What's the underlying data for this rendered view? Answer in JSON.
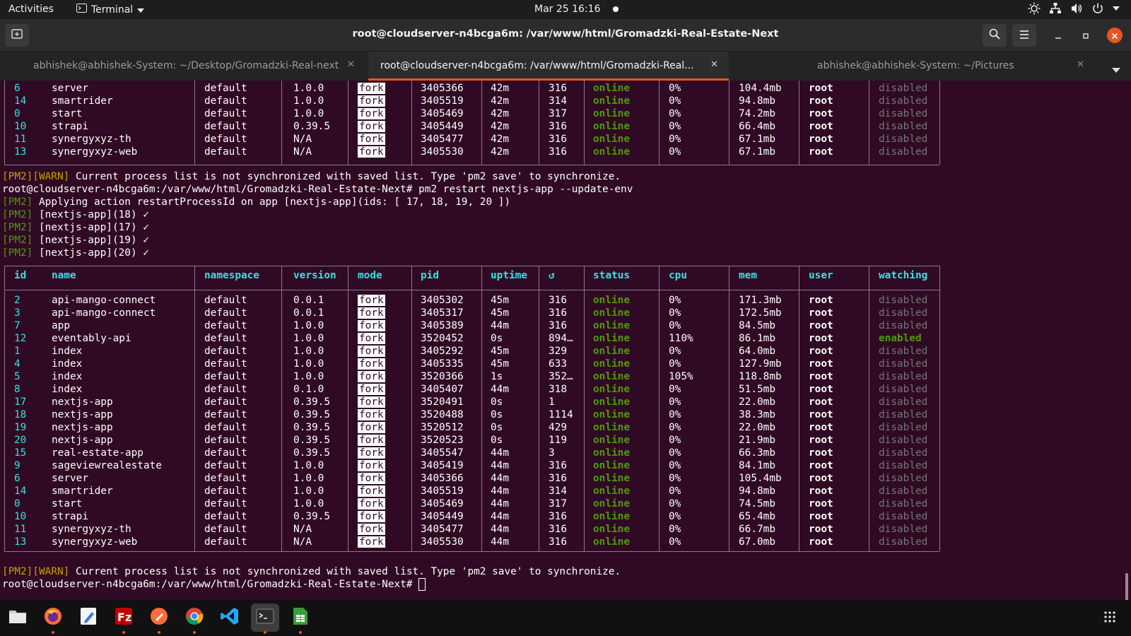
{
  "topbar": {
    "activities": "Activities",
    "app_name": "Terminal",
    "clock": "Mar 25  16:16"
  },
  "window": {
    "title": "root@cloudserver-n4bcga6m: /var/www/html/Gromadzki-Real-Estate-Next"
  },
  "tabs": [
    {
      "label": "abhishek@abhishek-System: ~/Desktop/Gromadzki-Real-next",
      "active": false
    },
    {
      "label": "root@cloudserver-n4bcga6m: /var/www/html/Gromadzki-Real...",
      "active": true
    },
    {
      "label": "abhishek@abhishek-System: ~/Pictures",
      "active": false
    }
  ],
  "close_glyph": "✕",
  "prev_table_rows": [
    {
      "id": "6",
      "name": "server",
      "namespace": "default",
      "version": "1.0.0",
      "mode": "fork",
      "pid": "3405366",
      "uptime": "42m",
      "restarts": "316",
      "status": "online",
      "cpu": "0%",
      "mem": "104.4mb",
      "user": "root",
      "watching": "disabled"
    },
    {
      "id": "14",
      "name": "smartrider",
      "namespace": "default",
      "version": "1.0.0",
      "mode": "fork",
      "pid": "3405519",
      "uptime": "42m",
      "restarts": "314",
      "status": "online",
      "cpu": "0%",
      "mem": "94.8mb",
      "user": "root",
      "watching": "disabled"
    },
    {
      "id": "0",
      "name": "start",
      "namespace": "default",
      "version": "1.0.0",
      "mode": "fork",
      "pid": "3405469",
      "uptime": "42m",
      "restarts": "317",
      "status": "online",
      "cpu": "0%",
      "mem": "74.2mb",
      "user": "root",
      "watching": "disabled"
    },
    {
      "id": "10",
      "name": "strapi",
      "namespace": "default",
      "version": "0.39.5",
      "mode": "fork",
      "pid": "3405449",
      "uptime": "42m",
      "restarts": "316",
      "status": "online",
      "cpu": "0%",
      "mem": "66.4mb",
      "user": "root",
      "watching": "disabled"
    },
    {
      "id": "11",
      "name": "synergyxyz-th",
      "namespace": "default",
      "version": "N/A",
      "mode": "fork",
      "pid": "3405477",
      "uptime": "42m",
      "restarts": "316",
      "status": "online",
      "cpu": "0%",
      "mem": "67.1mb",
      "user": "root",
      "watching": "disabled"
    },
    {
      "id": "13",
      "name": "synergyxyz-web",
      "namespace": "default",
      "version": "N/A",
      "mode": "fork",
      "pid": "3405530",
      "uptime": "42m",
      "restarts": "316",
      "status": "online",
      "cpu": "0%",
      "mem": "67.1mb",
      "user": "root",
      "watching": "disabled"
    }
  ],
  "log_lines": {
    "warn1_tag": "[PM2][WARN]",
    "warn1_text": " Current process list is not synchronized with saved list. Type 'pm2 save' to synchronize.",
    "command": "root@cloudserver-n4bcga6m:/var/www/html/Gromadzki-Real-Estate-Next# pm2 restart nextjs-app --update-env",
    "pm2_tag": "[PM2]",
    "apply": " Applying action restartProcessId on app [nextjs-app](ids: [ 17, 18, 19, 20 ])",
    "ok1": " [nextjs-app](18) ✓",
    "ok2": " [nextjs-app](17) ✓",
    "ok3": " [nextjs-app](19) ✓",
    "ok4": " [nextjs-app](20) ✓",
    "warn2_tag": "[PM2][WARN]",
    "warn2_text": " Current process list is not synchronized with saved list. Type 'pm2 save' to synchronize.",
    "prompt": "root@cloudserver-n4bcga6m:/var/www/html/Gromadzki-Real-Estate-Next# "
  },
  "table_headers": [
    "id",
    "name",
    "namespace",
    "version",
    "mode",
    "pid",
    "uptime",
    "↺",
    "status",
    "cpu",
    "mem",
    "user",
    "watching"
  ],
  "table_rows": [
    {
      "id": "2",
      "name": "api-mango-connect",
      "namespace": "default",
      "version": "0.0.1",
      "mode": "fork",
      "pid": "3405302",
      "uptime": "45m",
      "restarts": "316",
      "status": "online",
      "cpu": "0%",
      "mem": "171.3mb",
      "user": "root",
      "watching": "disabled"
    },
    {
      "id": "3",
      "name": "api-mango-connect",
      "namespace": "default",
      "version": "0.0.1",
      "mode": "fork",
      "pid": "3405317",
      "uptime": "45m",
      "restarts": "316",
      "status": "online",
      "cpu": "0%",
      "mem": "172.5mb",
      "user": "root",
      "watching": "disabled"
    },
    {
      "id": "7",
      "name": "app",
      "namespace": "default",
      "version": "1.0.0",
      "mode": "fork",
      "pid": "3405389",
      "uptime": "44m",
      "restarts": "316",
      "status": "online",
      "cpu": "0%",
      "mem": "84.5mb",
      "user": "root",
      "watching": "disabled"
    },
    {
      "id": "12",
      "name": "eventably-api",
      "namespace": "default",
      "version": "1.0.0",
      "mode": "fork",
      "pid": "3520452",
      "uptime": "0s",
      "restarts": "894…",
      "status": "online",
      "cpu": "110%",
      "mem": "86.1mb",
      "user": "root",
      "watching": "enabled"
    },
    {
      "id": "1",
      "name": "index",
      "namespace": "default",
      "version": "1.0.0",
      "mode": "fork",
      "pid": "3405292",
      "uptime": "45m",
      "restarts": "329",
      "status": "online",
      "cpu": "0%",
      "mem": "64.0mb",
      "user": "root",
      "watching": "disabled"
    },
    {
      "id": "4",
      "name": "index",
      "namespace": "default",
      "version": "1.0.0",
      "mode": "fork",
      "pid": "3405335",
      "uptime": "45m",
      "restarts": "633",
      "status": "online",
      "cpu": "0%",
      "mem": "127.9mb",
      "user": "root",
      "watching": "disabled"
    },
    {
      "id": "5",
      "name": "index",
      "namespace": "default",
      "version": "1.0.0",
      "mode": "fork",
      "pid": "3520366",
      "uptime": "1s",
      "restarts": "352…",
      "status": "online",
      "cpu": "105%",
      "mem": "118.8mb",
      "user": "root",
      "watching": "disabled"
    },
    {
      "id": "8",
      "name": "index",
      "namespace": "default",
      "version": "0.1.0",
      "mode": "fork",
      "pid": "3405407",
      "uptime": "44m",
      "restarts": "318",
      "status": "online",
      "cpu": "0%",
      "mem": "51.5mb",
      "user": "root",
      "watching": "disabled"
    },
    {
      "id": "17",
      "name": "nextjs-app",
      "namespace": "default",
      "version": "0.39.5",
      "mode": "fork",
      "pid": "3520491",
      "uptime": "0s",
      "restarts": "1",
      "status": "online",
      "cpu": "0%",
      "mem": "22.0mb",
      "user": "root",
      "watching": "disabled"
    },
    {
      "id": "18",
      "name": "nextjs-app",
      "namespace": "default",
      "version": "0.39.5",
      "mode": "fork",
      "pid": "3520488",
      "uptime": "0s",
      "restarts": "1114",
      "status": "online",
      "cpu": "0%",
      "mem": "38.3mb",
      "user": "root",
      "watching": "disabled"
    },
    {
      "id": "19",
      "name": "nextjs-app",
      "namespace": "default",
      "version": "0.39.5",
      "mode": "fork",
      "pid": "3520512",
      "uptime": "0s",
      "restarts": "429",
      "status": "online",
      "cpu": "0%",
      "mem": "22.0mb",
      "user": "root",
      "watching": "disabled"
    },
    {
      "id": "20",
      "name": "nextjs-app",
      "namespace": "default",
      "version": "0.39.5",
      "mode": "fork",
      "pid": "3520523",
      "uptime": "0s",
      "restarts": "119",
      "status": "online",
      "cpu": "0%",
      "mem": "21.9mb",
      "user": "root",
      "watching": "disabled"
    },
    {
      "id": "15",
      "name": "real-estate-app",
      "namespace": "default",
      "version": "0.39.5",
      "mode": "fork",
      "pid": "3405547",
      "uptime": "44m",
      "restarts": "3",
      "status": "online",
      "cpu": "0%",
      "mem": "66.3mb",
      "user": "root",
      "watching": "disabled"
    },
    {
      "id": "9",
      "name": "sageviewrealestate",
      "namespace": "default",
      "version": "1.0.0",
      "mode": "fork",
      "pid": "3405419",
      "uptime": "44m",
      "restarts": "316",
      "status": "online",
      "cpu": "0%",
      "mem": "84.1mb",
      "user": "root",
      "watching": "disabled"
    },
    {
      "id": "6",
      "name": "server",
      "namespace": "default",
      "version": "1.0.0",
      "mode": "fork",
      "pid": "3405366",
      "uptime": "44m",
      "restarts": "316",
      "status": "online",
      "cpu": "0%",
      "mem": "105.4mb",
      "user": "root",
      "watching": "disabled"
    },
    {
      "id": "14",
      "name": "smartrider",
      "namespace": "default",
      "version": "1.0.0",
      "mode": "fork",
      "pid": "3405519",
      "uptime": "44m",
      "restarts": "314",
      "status": "online",
      "cpu": "0%",
      "mem": "94.8mb",
      "user": "root",
      "watching": "disabled"
    },
    {
      "id": "0",
      "name": "start",
      "namespace": "default",
      "version": "1.0.0",
      "mode": "fork",
      "pid": "3405469",
      "uptime": "44m",
      "restarts": "317",
      "status": "online",
      "cpu": "0%",
      "mem": "74.5mb",
      "user": "root",
      "watching": "disabled"
    },
    {
      "id": "10",
      "name": "strapi",
      "namespace": "default",
      "version": "0.39.5",
      "mode": "fork",
      "pid": "3405449",
      "uptime": "44m",
      "restarts": "316",
      "status": "online",
      "cpu": "0%",
      "mem": "65.4mb",
      "user": "root",
      "watching": "disabled"
    },
    {
      "id": "11",
      "name": "synergyxyz-th",
      "namespace": "default",
      "version": "N/A",
      "mode": "fork",
      "pid": "3405477",
      "uptime": "44m",
      "restarts": "316",
      "status": "online",
      "cpu": "0%",
      "mem": "66.7mb",
      "user": "root",
      "watching": "disabled"
    },
    {
      "id": "13",
      "name": "synergyxyz-web",
      "namespace": "default",
      "version": "N/A",
      "mode": "fork",
      "pid": "3405530",
      "uptime": "44m",
      "restarts": "316",
      "status": "online",
      "cpu": "0%",
      "mem": "67.0mb",
      "user": "root",
      "watching": "disabled"
    }
  ],
  "dock": [
    {
      "name": "files-icon",
      "color": "#d9d9d9"
    },
    {
      "name": "firefox-icon",
      "color": "#ff7139"
    },
    {
      "name": "text-editor-icon",
      "color": "#4a90d9"
    },
    {
      "name": "filezilla-icon",
      "color": "#bf0000"
    },
    {
      "name": "postman-icon",
      "color": "#ff6c37"
    },
    {
      "name": "chrome-icon",
      "color": "#4285f4"
    },
    {
      "name": "vscode-icon",
      "color": "#23a9f2"
    },
    {
      "name": "terminal-icon",
      "color": "#2c2c2c"
    },
    {
      "name": "spreadsheet-icon",
      "color": "#3b9c3b"
    }
  ],
  "colors": {
    "terminal_bg": "#300a24",
    "accent": "#e95420",
    "header_cyan": "#34e2e2",
    "online_green": "#4e9a06",
    "warn_yellow": "#c4a000"
  }
}
